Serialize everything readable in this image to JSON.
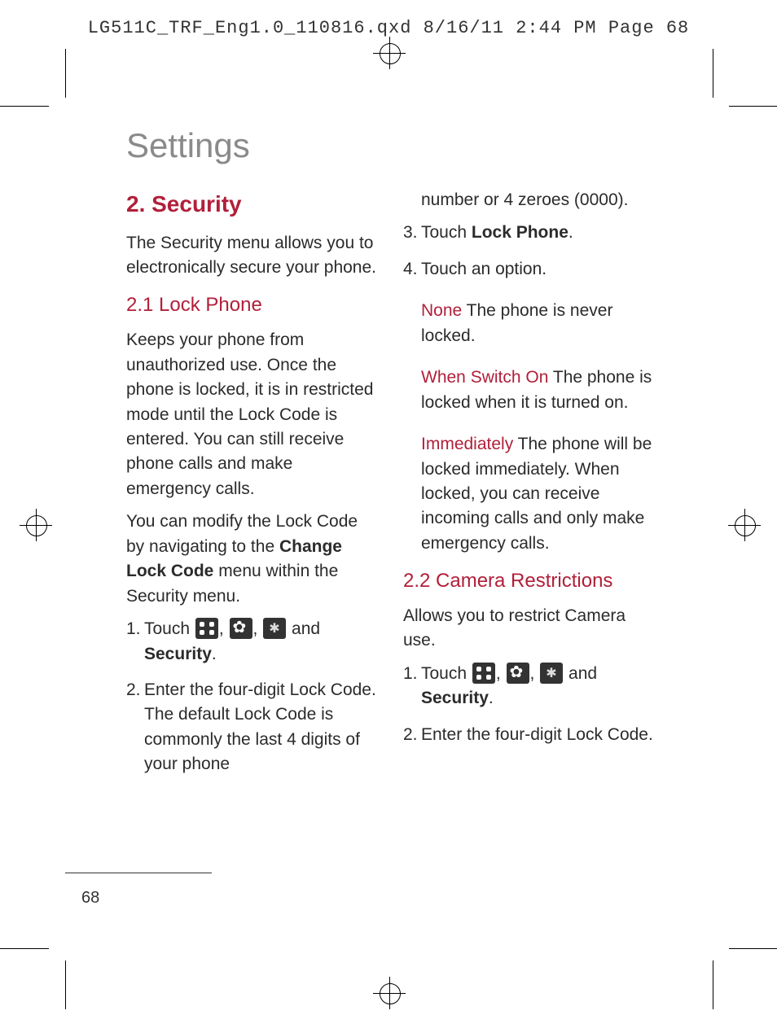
{
  "header": {
    "slug": "LG511C_TRF_Eng1.0_110816.qxd  8/16/11  2:44 PM  Page 68"
  },
  "page": {
    "title": "Settings",
    "number": "68"
  },
  "left": {
    "h2": "2. Security",
    "intro": "The Security menu allows you to electronically secure your phone.",
    "h3_1": "2.1 Lock Phone",
    "p1": "Keeps your phone from unauthorized use. Once the phone is locked, it is in restricted mode until the Lock Code is entered. You can still receive phone calls and make emergency calls.",
    "p2a": "You can modify the Lock Code by navigating to the ",
    "p2_bold": "Change Lock Code",
    "p2b": " menu within the Security menu.",
    "step1_num": "1.",
    "step1_pre": "Touch ",
    "step1_and": " and",
    "step1_sec": "Security",
    "period": ".",
    "comma": ", ",
    "step2_num": "2.",
    "step2": "Enter the four-digit Lock Code. The default Lock Code is commonly the last 4 digits of your phone"
  },
  "right": {
    "cont": "number or 4 zeroes (0000).",
    "step3_num": "3.",
    "step3_pre": "Touch ",
    "step3_bold": "Lock Phone",
    "step4_num": "4.",
    "step4": "Touch an option.",
    "opt1_red": "None",
    "opt1_rest": " The phone is never locked.",
    "opt2_red": "When Switch On",
    "opt2_rest": " The phone is locked when it is turned on.",
    "opt3_red": "Immediately",
    "opt3_rest": " The phone will be locked immediately. When locked, you can receive incoming calls and only make emergency calls.",
    "h3_2": "2.2 Camera Restrictions",
    "p3": "Allows you to restrict Camera use.",
    "cam_step1_num": "1.",
    "cam_step1_pre": "Touch ",
    "cam_step1_and": " and",
    "cam_step1_sec": "Security",
    "cam_step2_num": "2.",
    "cam_step2": "Enter the four-digit Lock Code."
  }
}
